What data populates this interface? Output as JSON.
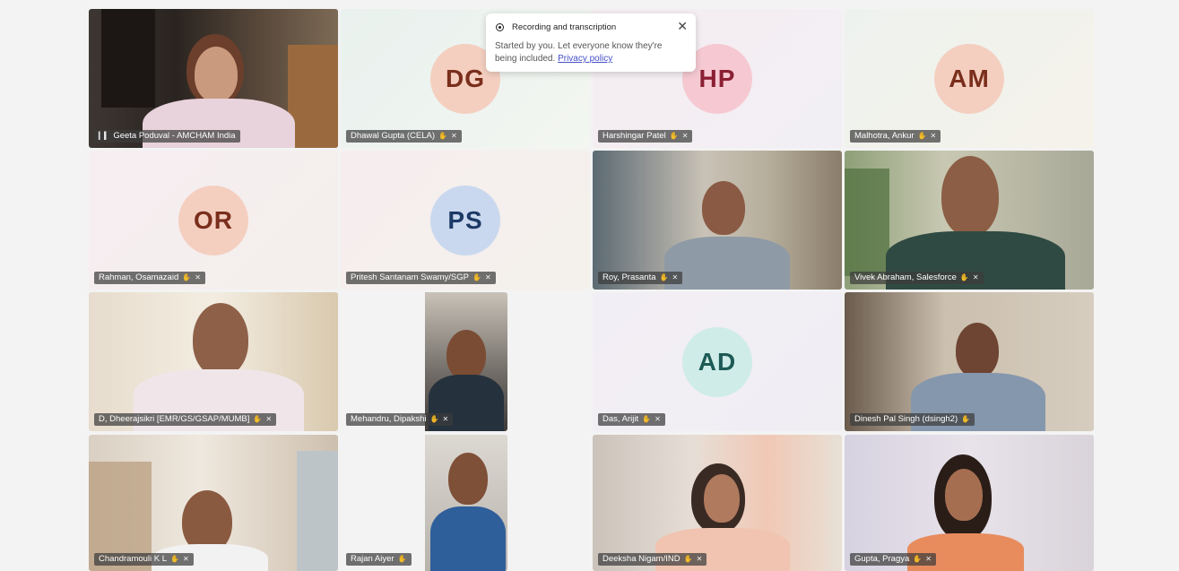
{
  "notification": {
    "title": "Recording and transcription",
    "message": "Started by you. Let everyone know they're being included.",
    "link": "Privacy policy"
  },
  "participants": [
    {
      "name": "Geeta Poduval - AMCHAM India",
      "initials": ""
    },
    {
      "name": "Dhawal Gupta (CELA)",
      "initials": "DG"
    },
    {
      "name": "Harshingar Patel",
      "initials": "HP"
    },
    {
      "name": "Malhotra, Ankur",
      "initials": "AM"
    },
    {
      "name": "Rahman, Osamazaid",
      "initials": "OR"
    },
    {
      "name": "Pritesh Santanam Swamy/SGP",
      "initials": "PS"
    },
    {
      "name": "Roy, Prasanta",
      "initials": ""
    },
    {
      "name": "Vivek Abraham, Salesforce",
      "initials": ""
    },
    {
      "name": "D, Dheerajsikri [EMR/GS/GSAP/MUMB]",
      "initials": ""
    },
    {
      "name": "Mehandru, Dipakshi",
      "initials": ""
    },
    {
      "name": "Das, Arijit",
      "initials": "AD"
    },
    {
      "name": "Dinesh Pal Singh (dsingh2)",
      "initials": ""
    },
    {
      "name": "Chandramouli K L",
      "initials": ""
    },
    {
      "name": "Rajan Aiyer",
      "initials": ""
    },
    {
      "name": "Deeksha Nigam/IND",
      "initials": ""
    },
    {
      "name": "Gupta, Pragya",
      "initials": ""
    }
  ],
  "colors": {
    "avatar_peach_bg": "#f4cfc0",
    "avatar_peach_text": "#7a2e1c",
    "avatar_pink_bg": "#f6c9d2",
    "avatar_pink_text": "#8a1f33",
    "avatar_blue_bg": "#c9d8ee",
    "avatar_blue_text": "#1d3a66",
    "avatar_teal_bg": "#cfece8",
    "avatar_teal_text": "#1e5a55"
  },
  "icons": {
    "signal": "signal-icon",
    "mic_muted": "mic-muted-icon",
    "pin": "pin-icon",
    "close": "close-icon",
    "record": "record-icon"
  }
}
